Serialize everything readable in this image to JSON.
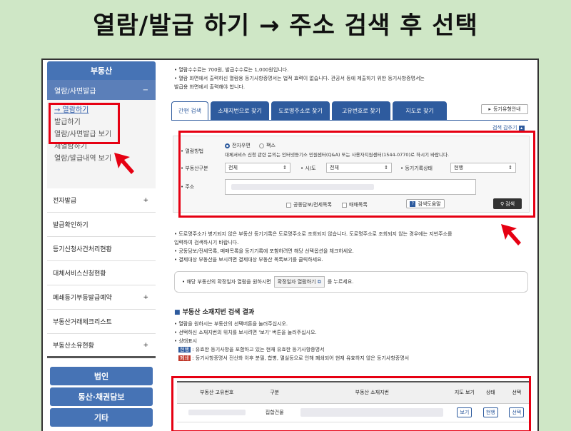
{
  "headline": "열람/발급 하기 → 주소 검색 후 선택",
  "sidebar": {
    "header": "부동산",
    "section": "열람/사면발급",
    "section_toggle": "−",
    "sub_items": [
      "→ 열람하기",
      "발급하기",
      "열람/사면발급 보기",
      "제열람하기",
      "열람/발급내역 보기"
    ],
    "rows": [
      {
        "label": "전자발급",
        "toggle": "+"
      },
      {
        "label": "발급확인하기",
        "toggle": ""
      },
      {
        "label": "등기신청사건처리현황",
        "toggle": ""
      },
      {
        "label": "대체서비스신청현황",
        "toggle": ""
      },
      {
        "label": "폐쇄등기부등발급예약",
        "toggle": "+"
      },
      {
        "label": "부동산거래체크리스트",
        "toggle": ""
      },
      {
        "label": "부동산소유현황",
        "toggle": "+"
      }
    ],
    "blue_items": [
      "법인",
      "동산·채권담보",
      "기타"
    ]
  },
  "notes": {
    "top": [
      "• 열람수수료는 700원, 발급수수료는 1,000원입니다.",
      "• 열람 화면에서 출력하신 열람용 등기사항증명서는 법적 효력이 없습니다. 관공서 등에 제출하기 위한 등기사항증명서는",
      "  발급용 화면에서 출력해야 합니다."
    ],
    "middle": [
      "• 도로명주소가 병기되지 않은 부동산 등기기록은 도로명주소로 조회되지 않습니다. 도로명주소로 조회되지 않는 경우에는 지번주소를",
      "  입력하여 검색하시기 바랍니다.",
      "• 공동담보/전세목록, 매매목록을 등기기록에 포함하려면 해당 선택옵션을 체크하세요.",
      "• 결제대상 부동산을 보시려면 결제대상 부동산 목록보기를 클릭하세요."
    ],
    "hint": "• 해당 부동산의 확정일자 열람을 원하시면",
    "hint_btn": "확정일자 열람하기",
    "hint_tail": "를 누르세요."
  },
  "tabs": [
    "간편 검색",
    "소재지번으로 찾기",
    "도로명주소로 찾기",
    "고유번호로 찾기",
    "지도로 찾기"
  ],
  "guide_button": "등기유형안내",
  "collapse_label": "검색 감추기",
  "search": {
    "view_method_label": "• 열람방법",
    "radio_1": "전자우편",
    "radio_2": "팩스",
    "service_note": "대체서비스 신청 관련 문의는 인터넷등기소 민원센터(Q&A) 또는 사용자지원센터(1544-0770)로 하시기 바랍니다.",
    "type_label": "• 부동산구분",
    "type_value": "전체",
    "city_label": "• 시/도",
    "city_value": "전체",
    "status_label": "• 등기기록상태",
    "status_value": "현행",
    "address_label": "• 주소",
    "check_1": "공동담보/전세목록",
    "check_2": "매매목록",
    "help_button": "검색도움말",
    "search_button": "검색"
  },
  "results": {
    "title": "부동산 소재지번 검색 결과",
    "notes": [
      "• 열람을 원하시는 부동산의 선택버튼을 눌러주십시오.",
      "• 선택하신 소재지번의 위치를 보시려면 '보기' 버튼을 눌러주십시오.",
      "• 상태표시"
    ],
    "legend_1_badge": "현행",
    "legend_1": ": 유효한 등기사항을 포함하고 있는 현재 유효한 등기사항증명서",
    "legend_2_badge": "폐쇄",
    "legend_2": ": 등기사항증명서 전산화 이후 분필, 합병, 멸실등으로 인해 폐쇄되어 현재 유효하지 않은 등기사항증명서",
    "columns": [
      "부동산 고유번호",
      "구분",
      "부동산 소재지번",
      "지도 보기",
      "상태",
      "선택"
    ],
    "row": {
      "type": "집합건물",
      "map": "보기",
      "status": "현행",
      "select": "선택"
    }
  }
}
